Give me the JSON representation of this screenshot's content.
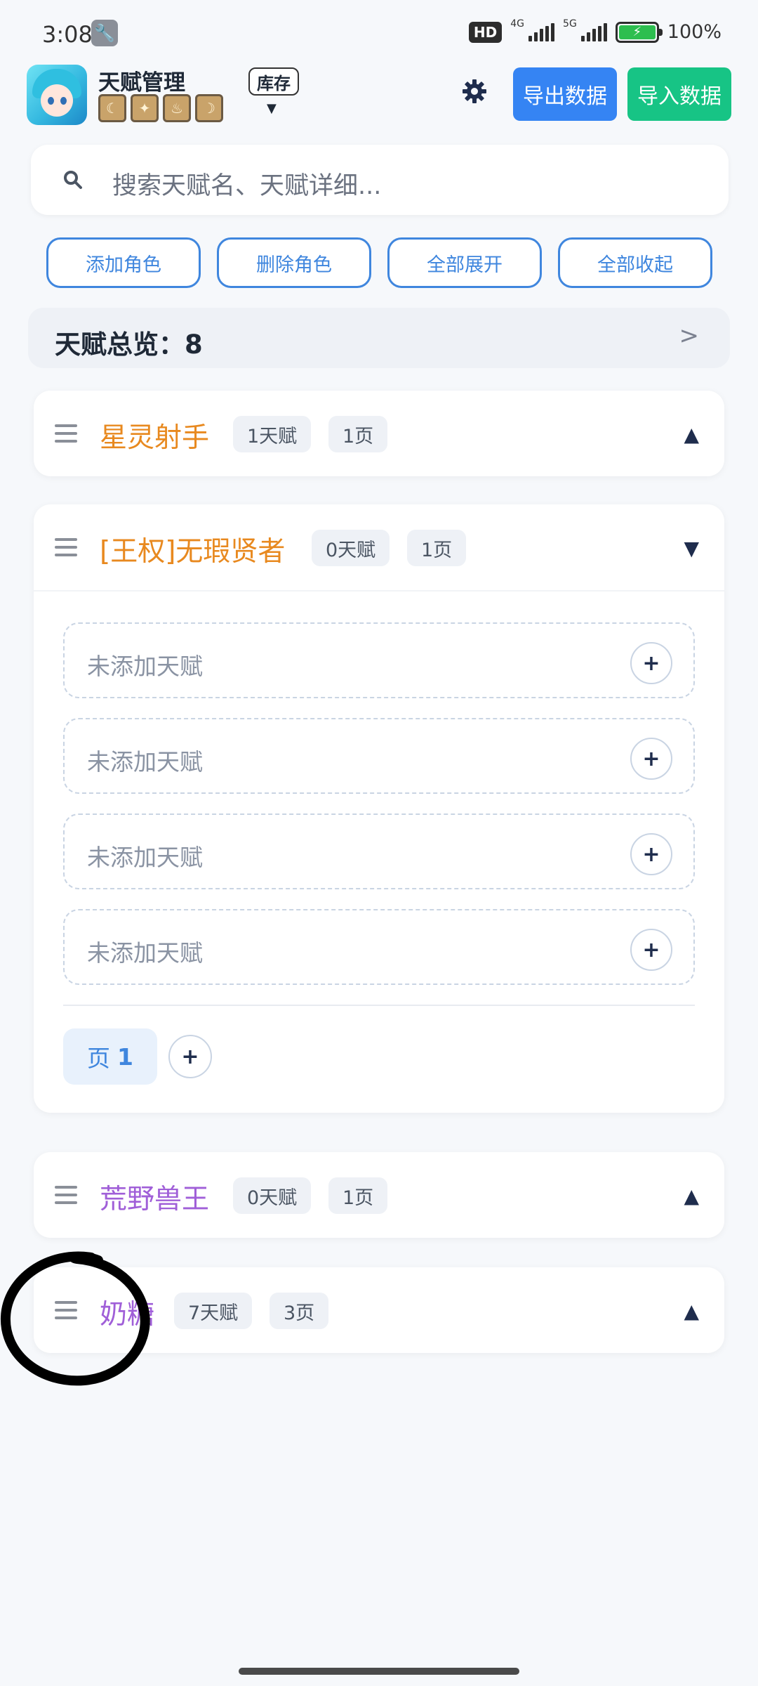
{
  "status_bar": {
    "time": "3:08",
    "hd": "HD",
    "net_1": "4G",
    "net_2": "5G",
    "battery": "100%"
  },
  "header": {
    "title": "天赋管理",
    "inventory_label": "库存",
    "export_label": "导出数据",
    "import_label": "导入数据"
  },
  "search": {
    "placeholder": "搜索天赋名、天赋详细..."
  },
  "actions": {
    "add_role": "添加角色",
    "delete_role": "删除角色",
    "expand_all": "全部展开",
    "collapse_all": "全部收起"
  },
  "overview": {
    "label": "天赋总览：8"
  },
  "roles": [
    {
      "name": "星灵射手",
      "talents": "1天赋",
      "pages": "1页",
      "color": "#e8891f",
      "expanded": false
    },
    {
      "name": "[王权]无瑕贤者",
      "talents": "0天赋",
      "pages": "1页",
      "color": "#e8891f",
      "expanded": true,
      "slots": [
        "未添加天赋",
        "未添加天赋",
        "未添加天赋",
        "未添加天赋"
      ],
      "page_tab": {
        "prefix": "页",
        "number": "1"
      }
    },
    {
      "name": "荒野兽王",
      "talents": "0天赋",
      "pages": "1页",
      "color": "#a05fd8",
      "expanded": false
    },
    {
      "name": "奶糖",
      "talents": "7天赋",
      "pages": "3页",
      "color": "#a05fd8",
      "expanded": false
    }
  ],
  "icons": {
    "add": "+",
    "expand": "▲",
    "collapse": "▼",
    "overview_arrow": ">",
    "caret": "▼"
  }
}
